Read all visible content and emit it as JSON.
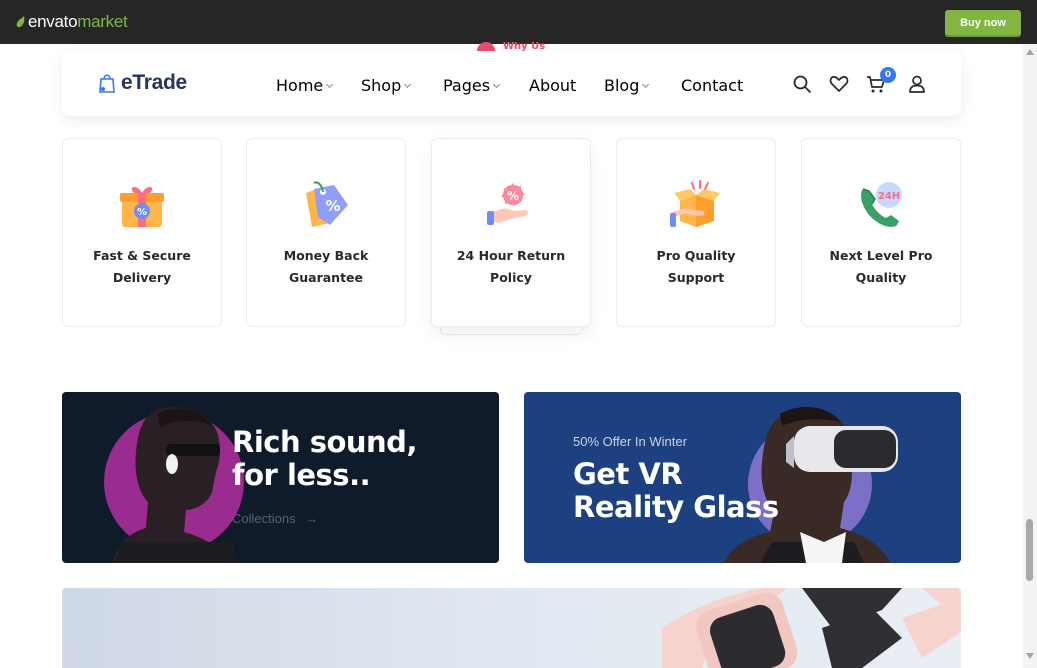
{
  "topbar": {
    "logo_text_1": "envato",
    "logo_text_2": "market",
    "buy_label": "Buy now",
    "accent": "#82b541"
  },
  "section_tag": "Why Us",
  "header": {
    "brand": "eTrade",
    "nav": [
      {
        "label": "Home",
        "dropdown": true
      },
      {
        "label": "Shop",
        "dropdown": true
      },
      {
        "label": "Pages",
        "dropdown": true
      },
      {
        "label": "About",
        "dropdown": false
      },
      {
        "label": "Blog",
        "dropdown": true
      },
      {
        "label": "Contact",
        "dropdown": false
      }
    ],
    "icons": [
      "search-icon",
      "heart-icon",
      "cart-icon",
      "user-icon"
    ],
    "cart_count": "0",
    "accent": "#3577f0"
  },
  "features": [
    {
      "line1": "Fast & Secure",
      "line2": "Delivery",
      "icon": "gift-percent-icon"
    },
    {
      "line1": "Money Back",
      "line2": "Guarantee",
      "icon": "price-tag-icon"
    },
    {
      "line1": "24 Hour Return",
      "line2": "Policy",
      "icon": "hand-percent-icon"
    },
    {
      "line1": "Pro Quality",
      "line2": "Support",
      "icon": "open-box-icon"
    },
    {
      "line1": "Next Level Pro",
      "line2": "Quality",
      "icon": "phone-24h-icon"
    }
  ],
  "promos": {
    "left": {
      "title_1": "Rich sound,",
      "title_2": "for less..",
      "link": "Collections"
    },
    "right": {
      "subtitle": "50% Offer In Winter",
      "title_1": "Get VR",
      "title_2": "Reality Glass"
    }
  }
}
